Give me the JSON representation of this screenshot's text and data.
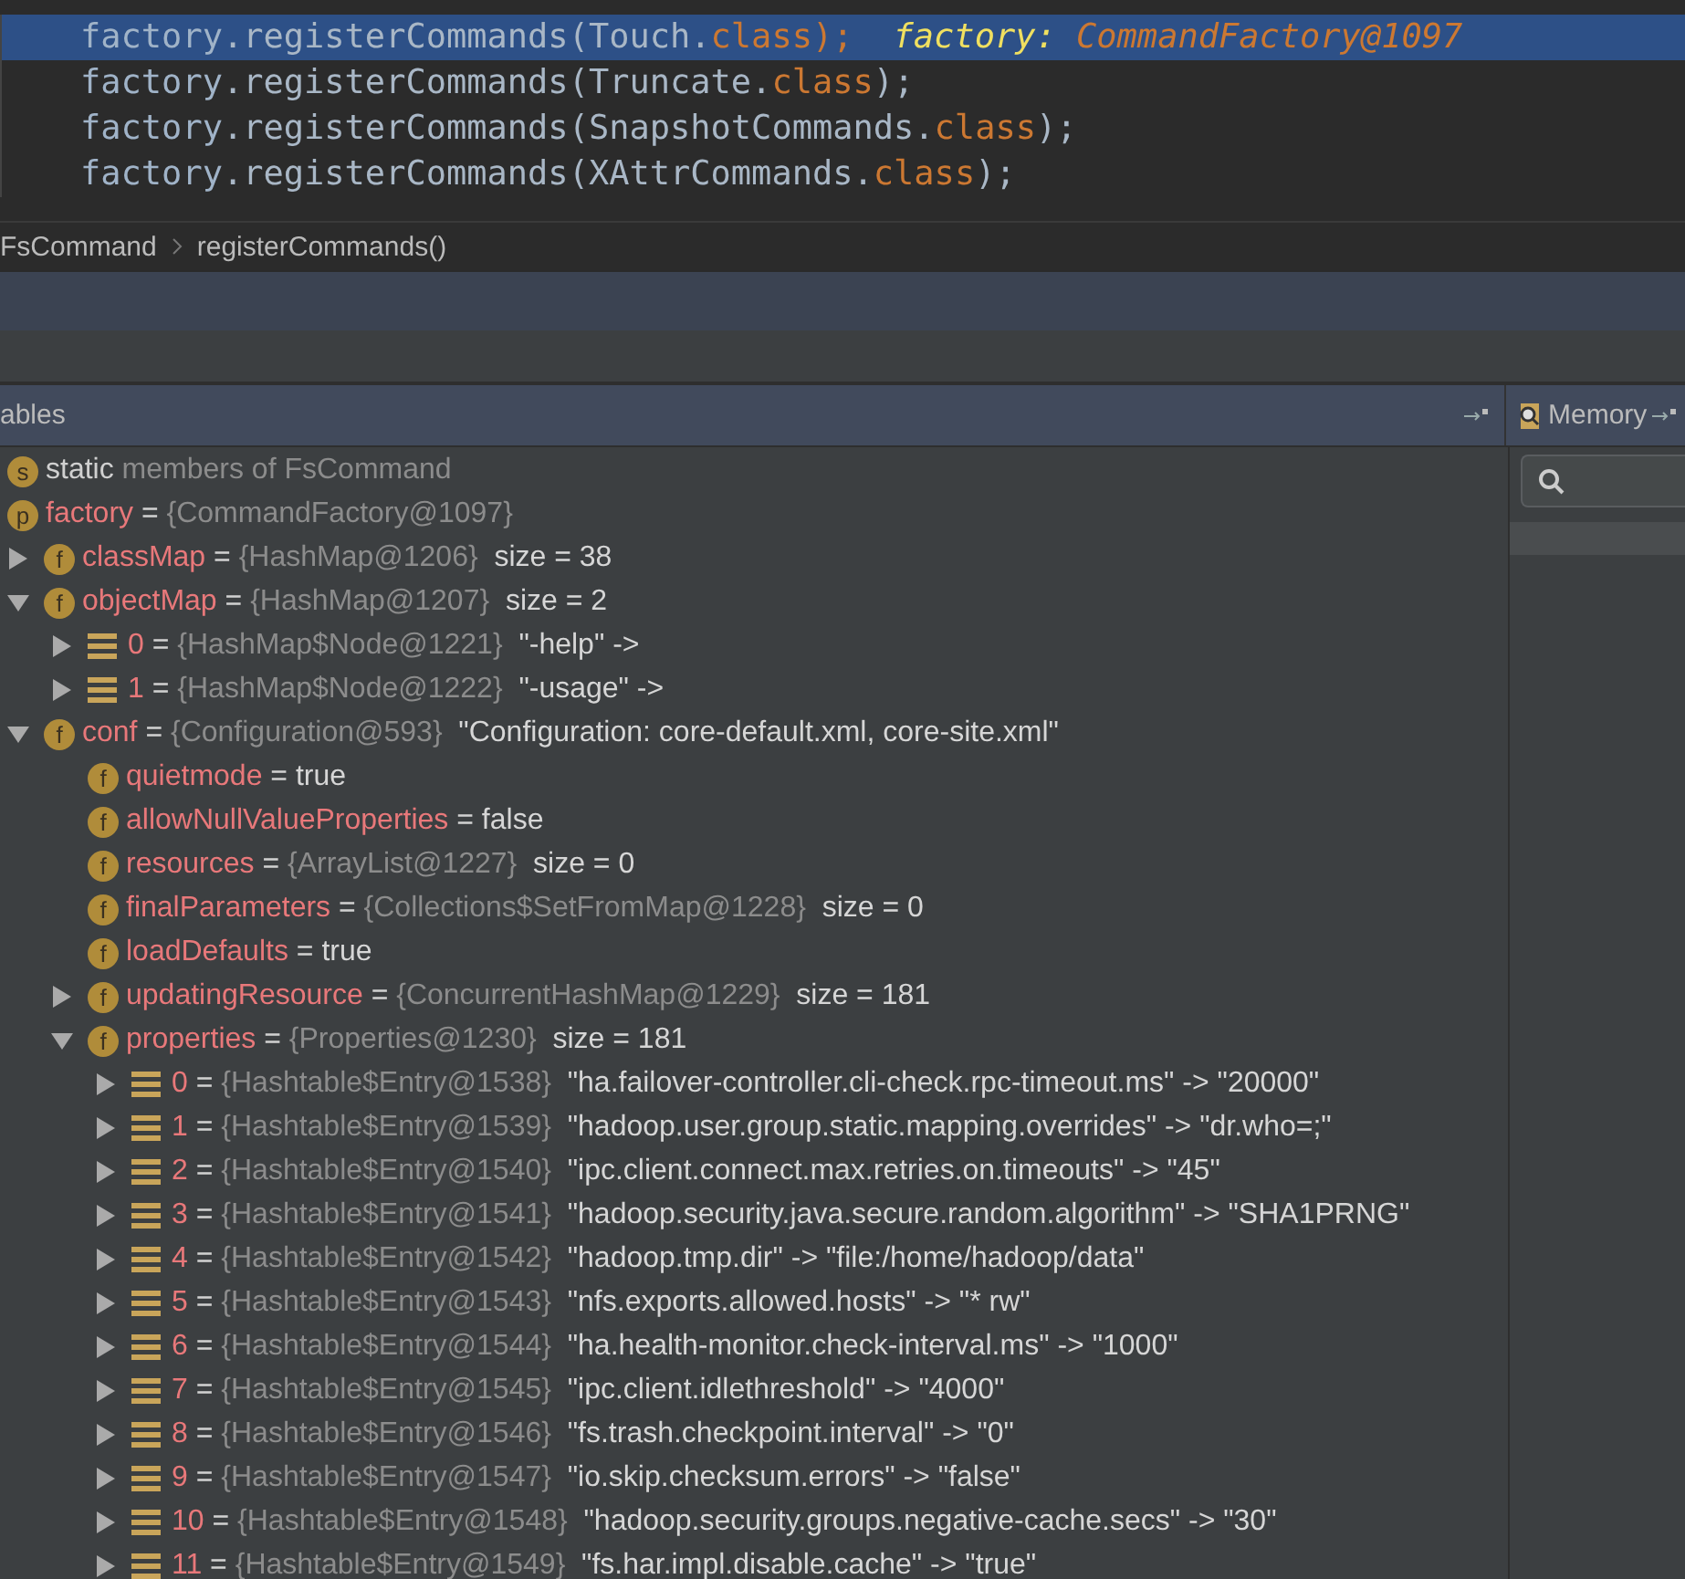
{
  "code_lines": [
    {
      "receiver": "factory",
      "call": ".registerCommands(",
      "arg": "Touch.",
      "keyword": "class",
      "end": ");",
      "selected": true,
      "inline_name": "factory:",
      "inline_value": "CommandFactory@1097"
    },
    {
      "receiver": "factory",
      "call": ".registerCommands(",
      "arg": "Truncate.",
      "keyword": "class",
      "end": ");",
      "selected": false
    },
    {
      "receiver": "factory",
      "call": ".registerCommands(",
      "arg": "SnapshotCommands.",
      "keyword": "class",
      "end": ");",
      "selected": false
    },
    {
      "receiver": "factory",
      "call": ".registerCommands(",
      "arg": "XAttrCommands.",
      "keyword": "class",
      "end": ");",
      "selected": false
    }
  ],
  "breadcrumb": [
    "FsCommand",
    "registerCommands()"
  ],
  "variables_panel": {
    "title": "ables",
    "memory_tab": "Memory"
  },
  "tree": [
    {
      "kind": "static",
      "badge": "s",
      "name": "static",
      "type": "members of FsCommand"
    },
    {
      "kind": "field",
      "badge": "p",
      "name": "factory",
      "op": "=",
      "type": "{CommandFactory@1097}"
    },
    {
      "kind": "field",
      "badge": "f",
      "name": "classMap",
      "op": "=",
      "type": "{HashMap@1206}",
      "extra": "size = 38",
      "expanded": false
    },
    {
      "kind": "field",
      "badge": "f",
      "name": "objectMap",
      "op": "=",
      "type": "{HashMap@1207}",
      "extra": "size = 2",
      "expanded": true,
      "children": [
        {
          "kind": "entry",
          "name": "0",
          "op": "=",
          "type": "{HashMap$Node@1221}",
          "extra": "\"-help\" ->",
          "expanded": false
        },
        {
          "kind": "entry",
          "name": "1",
          "op": "=",
          "type": "{HashMap$Node@1222}",
          "extra": "\"-usage\" ->",
          "expanded": false
        }
      ]
    },
    {
      "kind": "field",
      "badge": "f",
      "name": "conf",
      "op": "=",
      "type": "{Configuration@593}",
      "extra": "\"Configuration: core-default.xml, core-site.xml\"",
      "expanded": true,
      "children": [
        {
          "kind": "field",
          "badge": "f",
          "name": "quietmode",
          "op": "=",
          "extra": "true"
        },
        {
          "kind": "field",
          "badge": "f",
          "name": "allowNullValueProperties",
          "op": "=",
          "extra": "false"
        },
        {
          "kind": "field",
          "badge": "f",
          "name": "resources",
          "op": "=",
          "type": "{ArrayList@1227}",
          "extra": "size = 0"
        },
        {
          "kind": "field",
          "badge": "f",
          "name": "finalParameters",
          "op": "=",
          "type": "{Collections$SetFromMap@1228}",
          "extra": "size = 0"
        },
        {
          "kind": "field",
          "badge": "f",
          "name": "loadDefaults",
          "op": "=",
          "extra": "true"
        },
        {
          "kind": "field",
          "badge": "f",
          "name": "updatingResource",
          "op": "=",
          "type": "{ConcurrentHashMap@1229}",
          "extra": "size = 181",
          "expanded": false
        },
        {
          "kind": "field",
          "badge": "f",
          "name": "properties",
          "op": "=",
          "type": "{Properties@1230}",
          "extra": "size = 181",
          "expanded": true,
          "children": [
            {
              "kind": "entry",
              "name": "0",
              "op": "=",
              "type": "{Hashtable$Entry@1538}",
              "extra": "\"ha.failover-controller.cli-check.rpc-timeout.ms\" -> \"20000\"",
              "expanded": false
            },
            {
              "kind": "entry",
              "name": "1",
              "op": "=",
              "type": "{Hashtable$Entry@1539}",
              "extra": "\"hadoop.user.group.static.mapping.overrides\" -> \"dr.who=;\"",
              "expanded": false
            },
            {
              "kind": "entry",
              "name": "2",
              "op": "=",
              "type": "{Hashtable$Entry@1540}",
              "extra": "\"ipc.client.connect.max.retries.on.timeouts\" -> \"45\"",
              "expanded": false
            },
            {
              "kind": "entry",
              "name": "3",
              "op": "=",
              "type": "{Hashtable$Entry@1541}",
              "extra": "\"hadoop.security.java.secure.random.algorithm\" -> \"SHA1PRNG\"",
              "expanded": false
            },
            {
              "kind": "entry",
              "name": "4",
              "op": "=",
              "type": "{Hashtable$Entry@1542}",
              "extra": "\"hadoop.tmp.dir\" -> \"file:/home/hadoop/data\"",
              "expanded": false
            },
            {
              "kind": "entry",
              "name": "5",
              "op": "=",
              "type": "{Hashtable$Entry@1543}",
              "extra": "\"nfs.exports.allowed.hosts\" -> \"* rw\"",
              "expanded": false
            },
            {
              "kind": "entry",
              "name": "6",
              "op": "=",
              "type": "{Hashtable$Entry@1544}",
              "extra": "\"ha.health-monitor.check-interval.ms\" -> \"1000\"",
              "expanded": false
            },
            {
              "kind": "entry",
              "name": "7",
              "op": "=",
              "type": "{Hashtable$Entry@1545}",
              "extra": "\"ipc.client.idlethreshold\" -> \"4000\"",
              "expanded": false
            },
            {
              "kind": "entry",
              "name": "8",
              "op": "=",
              "type": "{Hashtable$Entry@1546}",
              "extra": "\"fs.trash.checkpoint.interval\" -> \"0\"",
              "expanded": false
            },
            {
              "kind": "entry",
              "name": "9",
              "op": "=",
              "type": "{Hashtable$Entry@1547}",
              "extra": "\"io.skip.checksum.errors\" -> \"false\"",
              "expanded": false
            },
            {
              "kind": "entry",
              "name": "10",
              "op": "=",
              "type": "{Hashtable$Entry@1548}",
              "extra": "\"hadoop.security.groups.negative-cache.secs\" -> \"30\"",
              "expanded": false
            },
            {
              "kind": "entry",
              "name": "11",
              "op": "=",
              "type": "{Hashtable$Entry@1549}",
              "extra": "\"fs.har.impl.disable.cache\" -> \"true\"",
              "expanded": false
            }
          ]
        }
      ]
    }
  ]
}
